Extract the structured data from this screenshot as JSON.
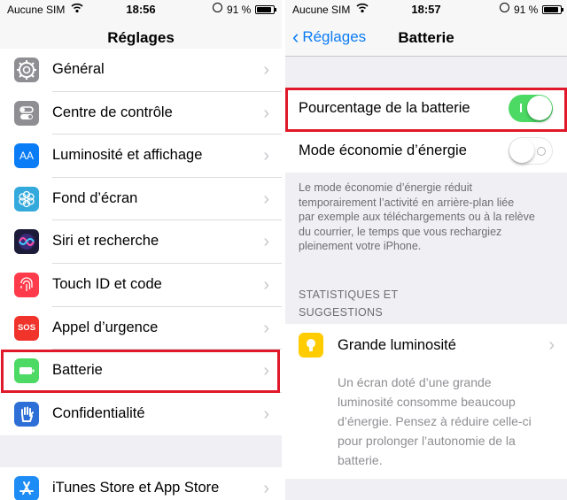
{
  "left": {
    "status": {
      "carrier": "Aucune SIM",
      "time": "18:56",
      "battery": "91 %"
    },
    "nav_title": "Réglages",
    "items": [
      {
        "label": "Général",
        "icon": "gear-icon",
        "color": "#8e8e93"
      },
      {
        "label": "Centre de contrôle",
        "icon": "toggles-icon",
        "color": "#8e8e93"
      },
      {
        "label": "Luminosité et affichage",
        "icon": "text-size-icon",
        "color": "#0a7cf5",
        "glyph": "AA"
      },
      {
        "label": "Fond d’écran",
        "icon": "flower-icon",
        "color": "#34aadc"
      },
      {
        "label": "Siri et recherche",
        "icon": "siri-icon",
        "color": "#1c1c3a"
      },
      {
        "label": "Touch ID et code",
        "icon": "fingerprint-icon",
        "color": "#ff3b4b"
      },
      {
        "label": "Appel d’urgence",
        "icon": "sos-icon",
        "color": "#f0332b",
        "glyph": "SOS"
      },
      {
        "label": "Batterie",
        "icon": "battery-icon",
        "color": "#4cd964"
      },
      {
        "label": "Confidentialité",
        "icon": "hand-icon",
        "color": "#2d6fd6"
      }
    ],
    "bottom_item": {
      "label": "iTunes Store et App Store",
      "icon": "app-store-icon",
      "color": "#1e8cf5"
    }
  },
  "right": {
    "status": {
      "carrier": "Aucune SIM",
      "time": "18:57",
      "battery": "91 %"
    },
    "back_label": "Réglages",
    "nav_title": "Batterie",
    "battery_percentage_label": "Pourcentage de la batterie",
    "battery_percentage_on": true,
    "low_power_label": "Mode économie d’énergie",
    "low_power_on": false,
    "low_power_desc_lines": [
      "Le mode économie d’énergie réduit",
      "temporairement l’activité en arrière-plan liée",
      "par exemple aux téléchargements ou à la relève",
      "du courrier, le temps que vous rechargiez",
      "pleinement votre iPhone."
    ],
    "section_header_lines": [
      "STATISTIQUES ET",
      "SUGGESTIONS"
    ],
    "suggestion_title": "Grande luminosité",
    "suggestion_icon": "lightbulb-icon",
    "suggestion_desc_lines": [
      "Un écran doté d’une grande",
      "luminosité consomme beaucoup",
      "d’énergie. Pensez à réduire celle-ci",
      "pour prolonger l’autonomie de la",
      "batterie."
    ]
  },
  "colors": {
    "highlight": "#e0192a",
    "ios_blue": "#0a7cf5",
    "toggle_green": "#4cd964"
  }
}
